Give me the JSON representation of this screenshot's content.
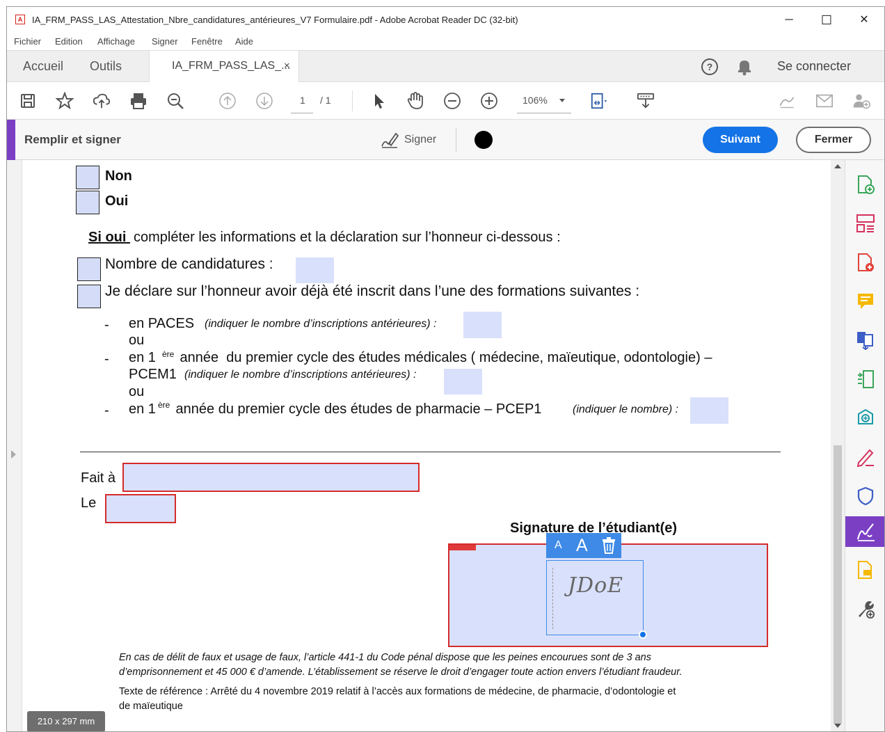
{
  "window": {
    "title": "IA_FRM_PASS_LAS_Attestation_Nbre_candidatures_antérieures_V7 Formulaire.pdf - Adobe Acrobat Reader DC (32-bit)",
    "minimize": "─",
    "maximize": "☐",
    "close": "✕"
  },
  "menu": [
    "Fichier",
    "Edition",
    "Affichage",
    "Signer",
    "Fenêtre",
    "Aide"
  ],
  "tabs": {
    "home": "Accueil",
    "tools": "Outils",
    "document": "IA_FRM_PASS_LAS_...",
    "document_close": "×",
    "sign_in": "Se connecter"
  },
  "toolbar": {
    "page_current": "1",
    "page_total": "/ 1",
    "zoom": "106%"
  },
  "fill_sign": {
    "title": "Remplir et signer",
    "sign_label": "Signer",
    "next_button": "Suivant",
    "close_button": "Fermer"
  },
  "form": {
    "option_no": "Non",
    "option_yes": "Oui",
    "if_yes_prefix": "Si oui ",
    "if_yes_text": "compléter les informations et la déclaration sur l’honneur ci-dessous :",
    "nb_candidatures": "Nombre de candidatures :",
    "declaration": "Je déclare sur l’honneur avoir déjà été inscrit dans l’une des formations suivantes :",
    "dash": "-",
    "paces": "en PACES",
    "paces_hint": "(indiquer le nombre d’inscriptions antérieures) :",
    "or1": "ou",
    "medical_pre": "en 1",
    "medical_sup": "ère",
    "medical_post": " année  du premier cycle des études médicales ( médecine, maïeutique, odontologie) –",
    "pcem1": "PCEM1",
    "pcem1_hint": "(indiquer le nombre d’inscriptions antérieures) :",
    "or2": "ou",
    "pharma_pre": "en 1",
    "pharma_sup": "ère",
    "pharma_post": " année du premier cycle des études de pharmacie – PCEP1",
    "pharma_hint": "(indiquer le nombre) :",
    "fait_a": "Fait à",
    "le": "Le",
    "signature_label": "Signature de l’étudiant(e)",
    "signature_text": "JDoE",
    "sig_toolbar_small": "A",
    "sig_toolbar_large": "A",
    "legal_line1": "En cas de délit de faux et usage de faux, l’article 441-1 du Code pénal dispose que les peines encourues sont de 3 ans",
    "legal_line2": "d’emprisonnement et 45 000 € d’amende. L’établissement se réserve le droit d’engager toute action envers l’étudiant fraudeur.",
    "ref_line1": "Texte de référence : Arrêté du 4 novembre 2019 relatif à l’accès aux formations de médecine, de pharmacie, d’odontologie et",
    "ref_line2": "de maïeutique"
  },
  "page_size": "210 x 297 mm",
  "colors": {
    "accent_purple": "#7b3fc4",
    "primary_blue": "#1473e6",
    "field_fill": "#d9e0fb",
    "field_border_red": "#d42b2b"
  }
}
